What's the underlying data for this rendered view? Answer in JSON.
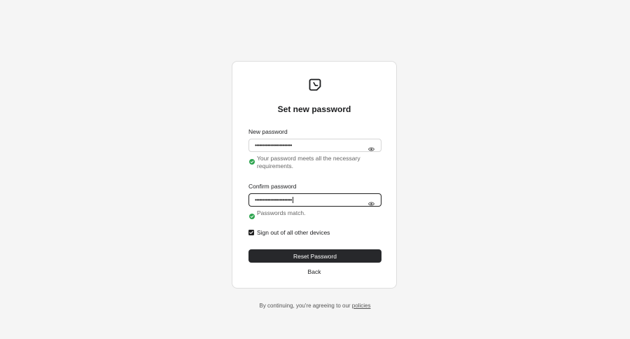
{
  "title": "Set new password",
  "new_password": {
    "label": "New password",
    "value": "••••••••••••••••••••••••",
    "toggle_icon": "eye-icon",
    "hint": "Your password meets all the necessary requirements."
  },
  "confirm_password": {
    "label": "Confirm password",
    "value": "••••••••••••••••••••••••",
    "toggle_icon": "eye-icon",
    "hint": "Passwords match."
  },
  "sign_out_option": {
    "label": "Sign out of all other devices",
    "checked": true
  },
  "reset_button": "Reset Password",
  "back_link": "Back",
  "footer": {
    "text": "By continuing, you're agreeing to our",
    "link": "policies"
  },
  "colors": {
    "background": "#f5f5f5",
    "card": "#ffffff",
    "primary_button": "#27282b",
    "success": "#2ea44f",
    "hint_text": "#666666"
  }
}
